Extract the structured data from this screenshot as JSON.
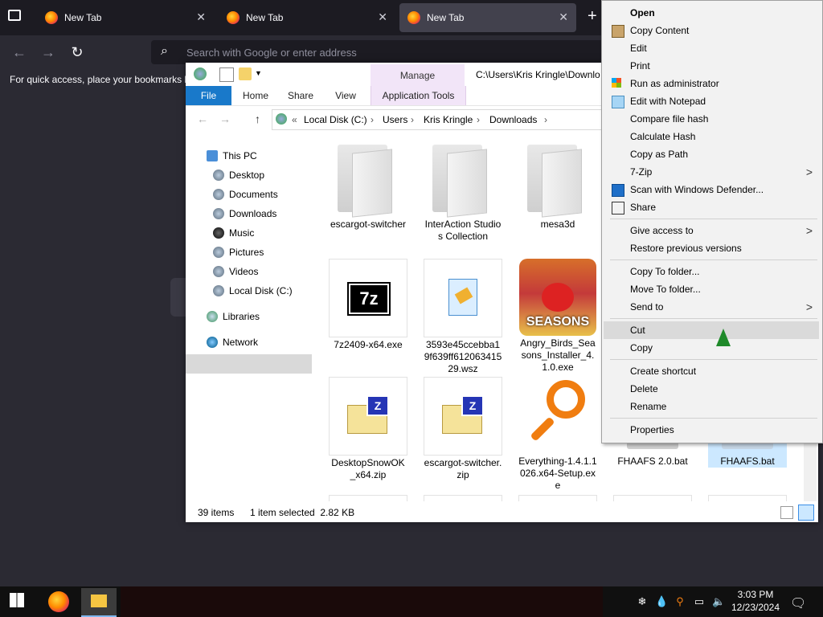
{
  "firefox": {
    "tabs": [
      {
        "title": "New Tab"
      },
      {
        "title": "New Tab"
      },
      {
        "title": "New Tab"
      }
    ],
    "new_tab_glyph": "+",
    "url_placeholder": "Search with Google or enter address",
    "bookmarks_hint": "For quick access, place your bookmarks h"
  },
  "explorer": {
    "title_path": "C:\\Users\\Kris Kringle\\Downlo",
    "ribbon": {
      "context_tab": "Manage",
      "tabs": [
        "File",
        "Home",
        "Share",
        "View",
        "Application Tools"
      ]
    },
    "address": {
      "prefix": "«",
      "crumbs": [
        "Local Disk (C:)",
        "Users",
        "Kris Kringle",
        "Downloads"
      ]
    },
    "nav": [
      {
        "label": "This PC",
        "icon": "pc-icon"
      },
      {
        "label": "Desktop",
        "icon": "desktop-icon"
      },
      {
        "label": "Documents",
        "icon": "documents-icon"
      },
      {
        "label": "Downloads",
        "icon": "downloads-icon"
      },
      {
        "label": "Music",
        "icon": "music-icon"
      },
      {
        "label": "Pictures",
        "icon": "pictures-icon"
      },
      {
        "label": "Videos",
        "icon": "videos-icon"
      },
      {
        "label": "Local Disk (C:)",
        "icon": "drive-icon"
      },
      {
        "label": "Libraries",
        "icon": "libraries-icon"
      },
      {
        "label": "Network",
        "icon": "network-icon"
      }
    ],
    "files": [
      {
        "name": "escargot-switcher",
        "kind": "folder"
      },
      {
        "name": "InterAction Studios Collection",
        "kind": "folder"
      },
      {
        "name": "mesa3d",
        "kind": "folder"
      },
      {
        "name": "7z2409-x64.exe",
        "kind": "7zip"
      },
      {
        "name": "3593e45ccebba19f639ff61206341529.wsz",
        "kind": "wsz"
      },
      {
        "name": "Angry_Birds_Seasons_Installer_4.1.0.exe",
        "kind": "angrybirds"
      },
      {
        "name": "DesktopSnowOK_x64.zip",
        "kind": "zip"
      },
      {
        "name": "escargot-switcher.zip",
        "kind": "zip"
      },
      {
        "name": "Everything-1.4.1.1026.x64-Setup.exe",
        "kind": "everything"
      },
      {
        "name": "FHAAFS 2.0.bat",
        "kind": "bat"
      },
      {
        "name": "FHAAFS.bat",
        "kind": "bat"
      }
    ],
    "angry_birds_label": "SEASONS",
    "status": {
      "count": "39 items",
      "selection": "1 item selected  2.82 KB"
    }
  },
  "context_menu": {
    "items": [
      {
        "label": "Open",
        "bold": true
      },
      {
        "label": "Copy Content",
        "icon": "clipboard-icon"
      },
      {
        "label": "Edit"
      },
      {
        "label": "Print"
      },
      {
        "label": "Run as administrator",
        "icon": "shield-icon"
      },
      {
        "label": "Edit with Notepad",
        "icon": "notepad-icon"
      },
      {
        "label": "Compare file hash"
      },
      {
        "label": "Calculate Hash"
      },
      {
        "label": "Copy as Path"
      },
      {
        "label": "7-Zip",
        "submenu": true
      },
      {
        "label": "Scan with Windows Defender...",
        "icon": "defender-icon"
      },
      {
        "label": "Share",
        "icon": "share-icon"
      },
      {
        "label": "Give access to",
        "submenu": true
      },
      {
        "label": "Restore previous versions"
      },
      {
        "label": "Copy To folder..."
      },
      {
        "label": "Move To folder..."
      },
      {
        "label": "Send to",
        "submenu": true
      },
      {
        "label": "Cut",
        "hovered": true
      },
      {
        "label": "Copy"
      },
      {
        "label": "Create shortcut"
      },
      {
        "label": "Delete"
      },
      {
        "label": "Rename"
      },
      {
        "label": "Properties"
      }
    ],
    "arrow_glyph": ">"
  },
  "taskbar": {
    "time": "3:03 PM",
    "date": "12/23/2024"
  },
  "colors": {
    "ribbon_file": "#1979ca",
    "manage_tab": "#f2e5f8",
    "selection": "#cce8ff"
  }
}
